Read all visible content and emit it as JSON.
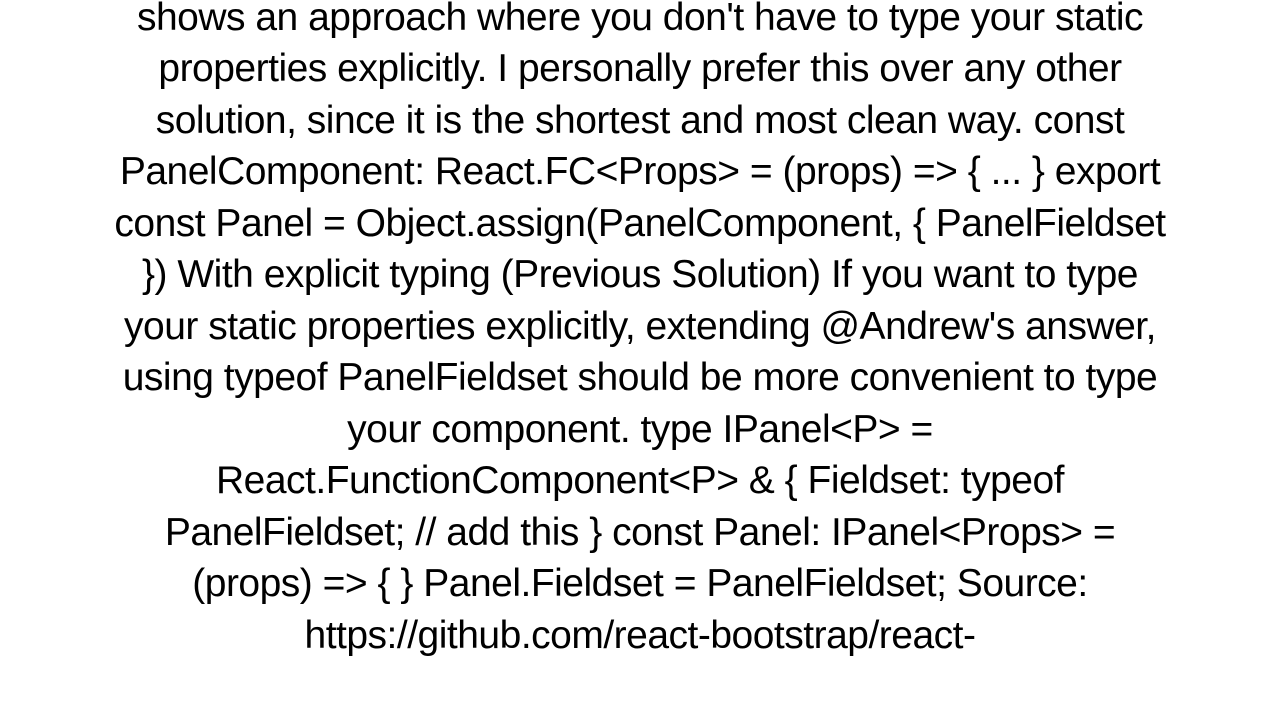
{
  "document": {
    "text": "shows an approach where you don't have to type your static properties explicitly. I personally prefer this over any other solution, since it is the shortest and most clean way. const PanelComponent: React.FC<Props> = (props) => {  ... }  export const Panel = Object.assign(PanelComponent, { PanelFieldset })  With explicit typing (Previous Solution) If you want to type your static properties explicitly, extending @Andrew's answer, using typeof PanelFieldset should be more convenient to type your component. type IPanel<P> = React.FunctionComponent<P> & {   Fieldset: typeof PanelFieldset; // add this }  const Panel: IPanel<Props> = (props) => { }  Panel.Fieldset = PanelFieldset;  Source: https://github.com/react-bootstrap/react-"
  }
}
